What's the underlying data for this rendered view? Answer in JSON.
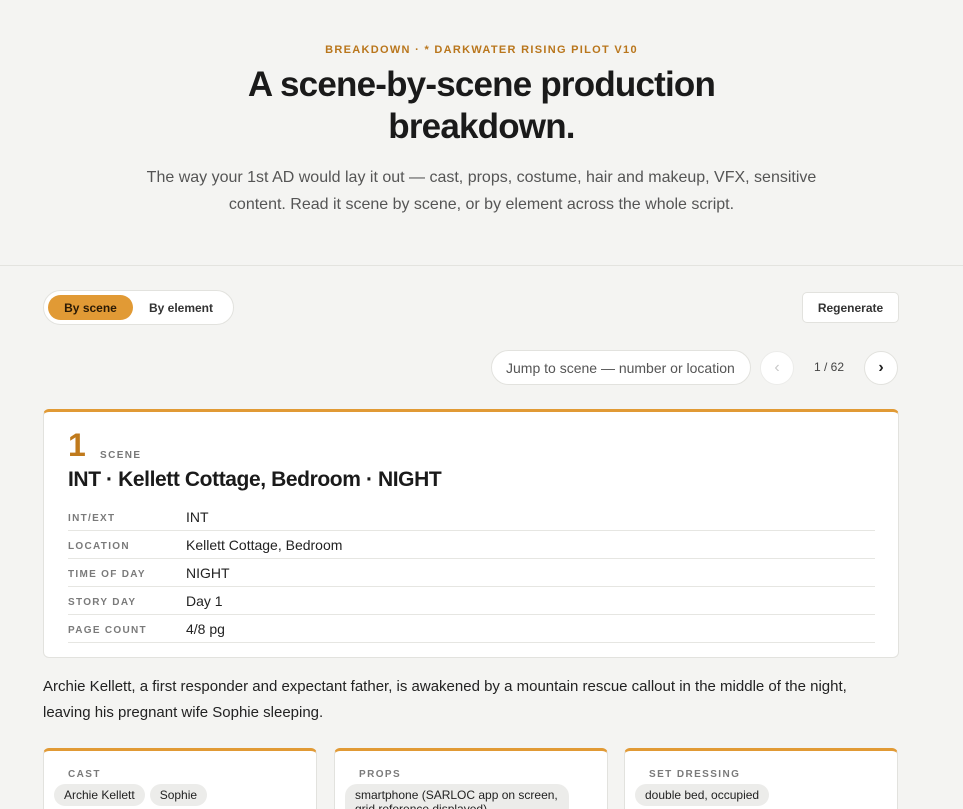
{
  "header": {
    "eyebrow": "BREAKDOWN · * DARKWATER RISING PILOT V10",
    "title_line1": "A scene-by-scene production",
    "title_line2": "breakdown.",
    "subtitle": "The way your 1st AD would lay it out — cast, props, costume, hair and makeup, VFX, sensitive content. Read it scene by scene, or by element across the whole script."
  },
  "toolbar": {
    "view_by_scene": "By scene",
    "view_by_element": "By element",
    "active_view": "By scene",
    "regenerate_label": "Regenerate",
    "jump_placeholder": "Jump to scene — number or location",
    "prev_icon": "‹",
    "next_icon": "›",
    "pager": "1 / 62"
  },
  "scene": {
    "number": "1",
    "tag": "SCENE",
    "heading": "INT · Kellett Cottage, Bedroom · NIGHT",
    "meta": [
      {
        "label": "INT/EXT",
        "value": "INT"
      },
      {
        "label": "LOCATION",
        "value": "Kellett Cottage, Bedroom"
      },
      {
        "label": "TIME OF DAY",
        "value": "NIGHT"
      },
      {
        "label": "STORY DAY",
        "value": "Day 1"
      },
      {
        "label": "PAGE COUNT",
        "value": "4/8 pg"
      }
    ],
    "synopsis": "Archie Kellett, a first responder and expectant father, is awakened by a mountain rescue callout in the middle of the night, leaving his pregnant wife Sophie sleeping."
  },
  "elements": {
    "cast": {
      "label": "CAST",
      "items": [
        "Archie Kellett",
        "Sophie"
      ]
    },
    "props": {
      "label": "PROPS",
      "items": [
        "smartphone (SARLOC app on screen, grid reference displayed)"
      ]
    },
    "set_dressing": {
      "label": "SET DRESSING",
      "items": [
        "double bed, occupied"
      ]
    }
  },
  "colors": {
    "accent": "#e19a35",
    "accent_text": "#b9761c",
    "background": "#f4f4f2"
  }
}
